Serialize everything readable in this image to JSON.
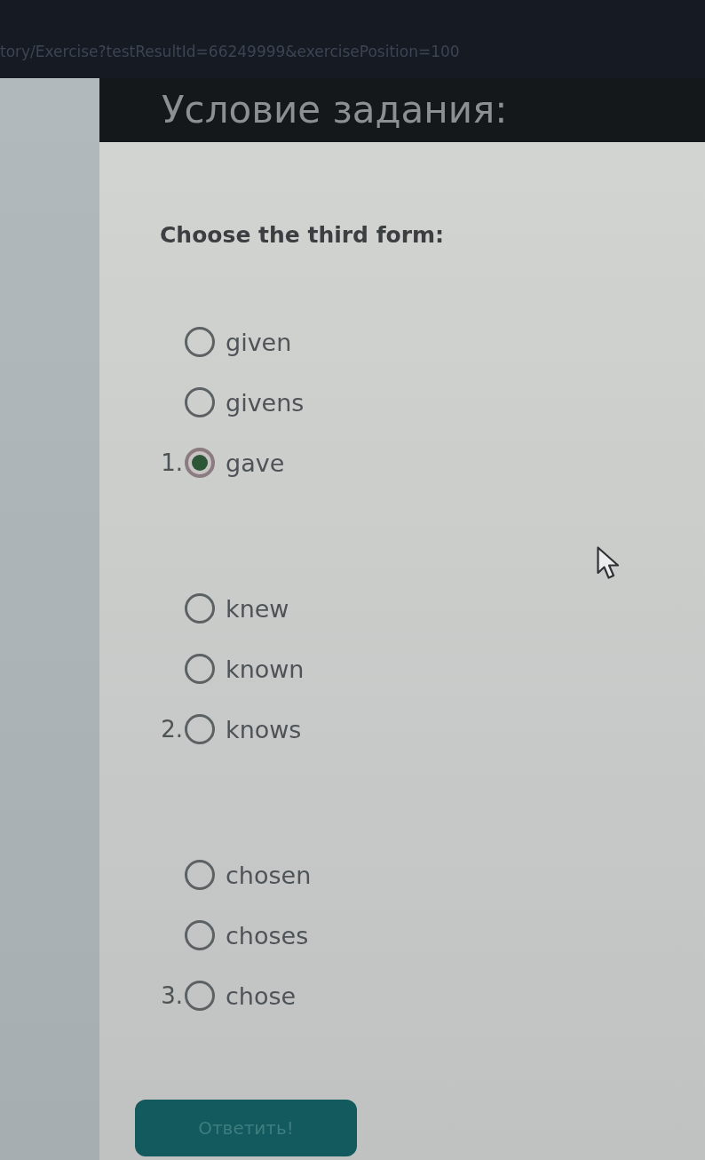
{
  "browser": {
    "url": "tory/Exercise?testResultId=66249999&exercisePosition=100"
  },
  "header": {
    "title": "Условие задания:"
  },
  "question": {
    "prompt": "Choose the third form:"
  },
  "groups": [
    {
      "options": [
        {
          "label": "given",
          "selected": false
        },
        {
          "label": "givens",
          "selected": false
        },
        {
          "label": "gave",
          "selected": true,
          "number": "1."
        }
      ]
    },
    {
      "options": [
        {
          "label": "knew",
          "selected": false
        },
        {
          "label": "known",
          "selected": false
        },
        {
          "label": "knows",
          "selected": false,
          "number": "2."
        }
      ]
    },
    {
      "options": [
        {
          "label": "chosen",
          "selected": false
        },
        {
          "label": "choses",
          "selected": false
        },
        {
          "label": "chose",
          "selected": false,
          "number": "3."
        }
      ]
    }
  ],
  "submit_button": {
    "label": "Ответить!"
  }
}
